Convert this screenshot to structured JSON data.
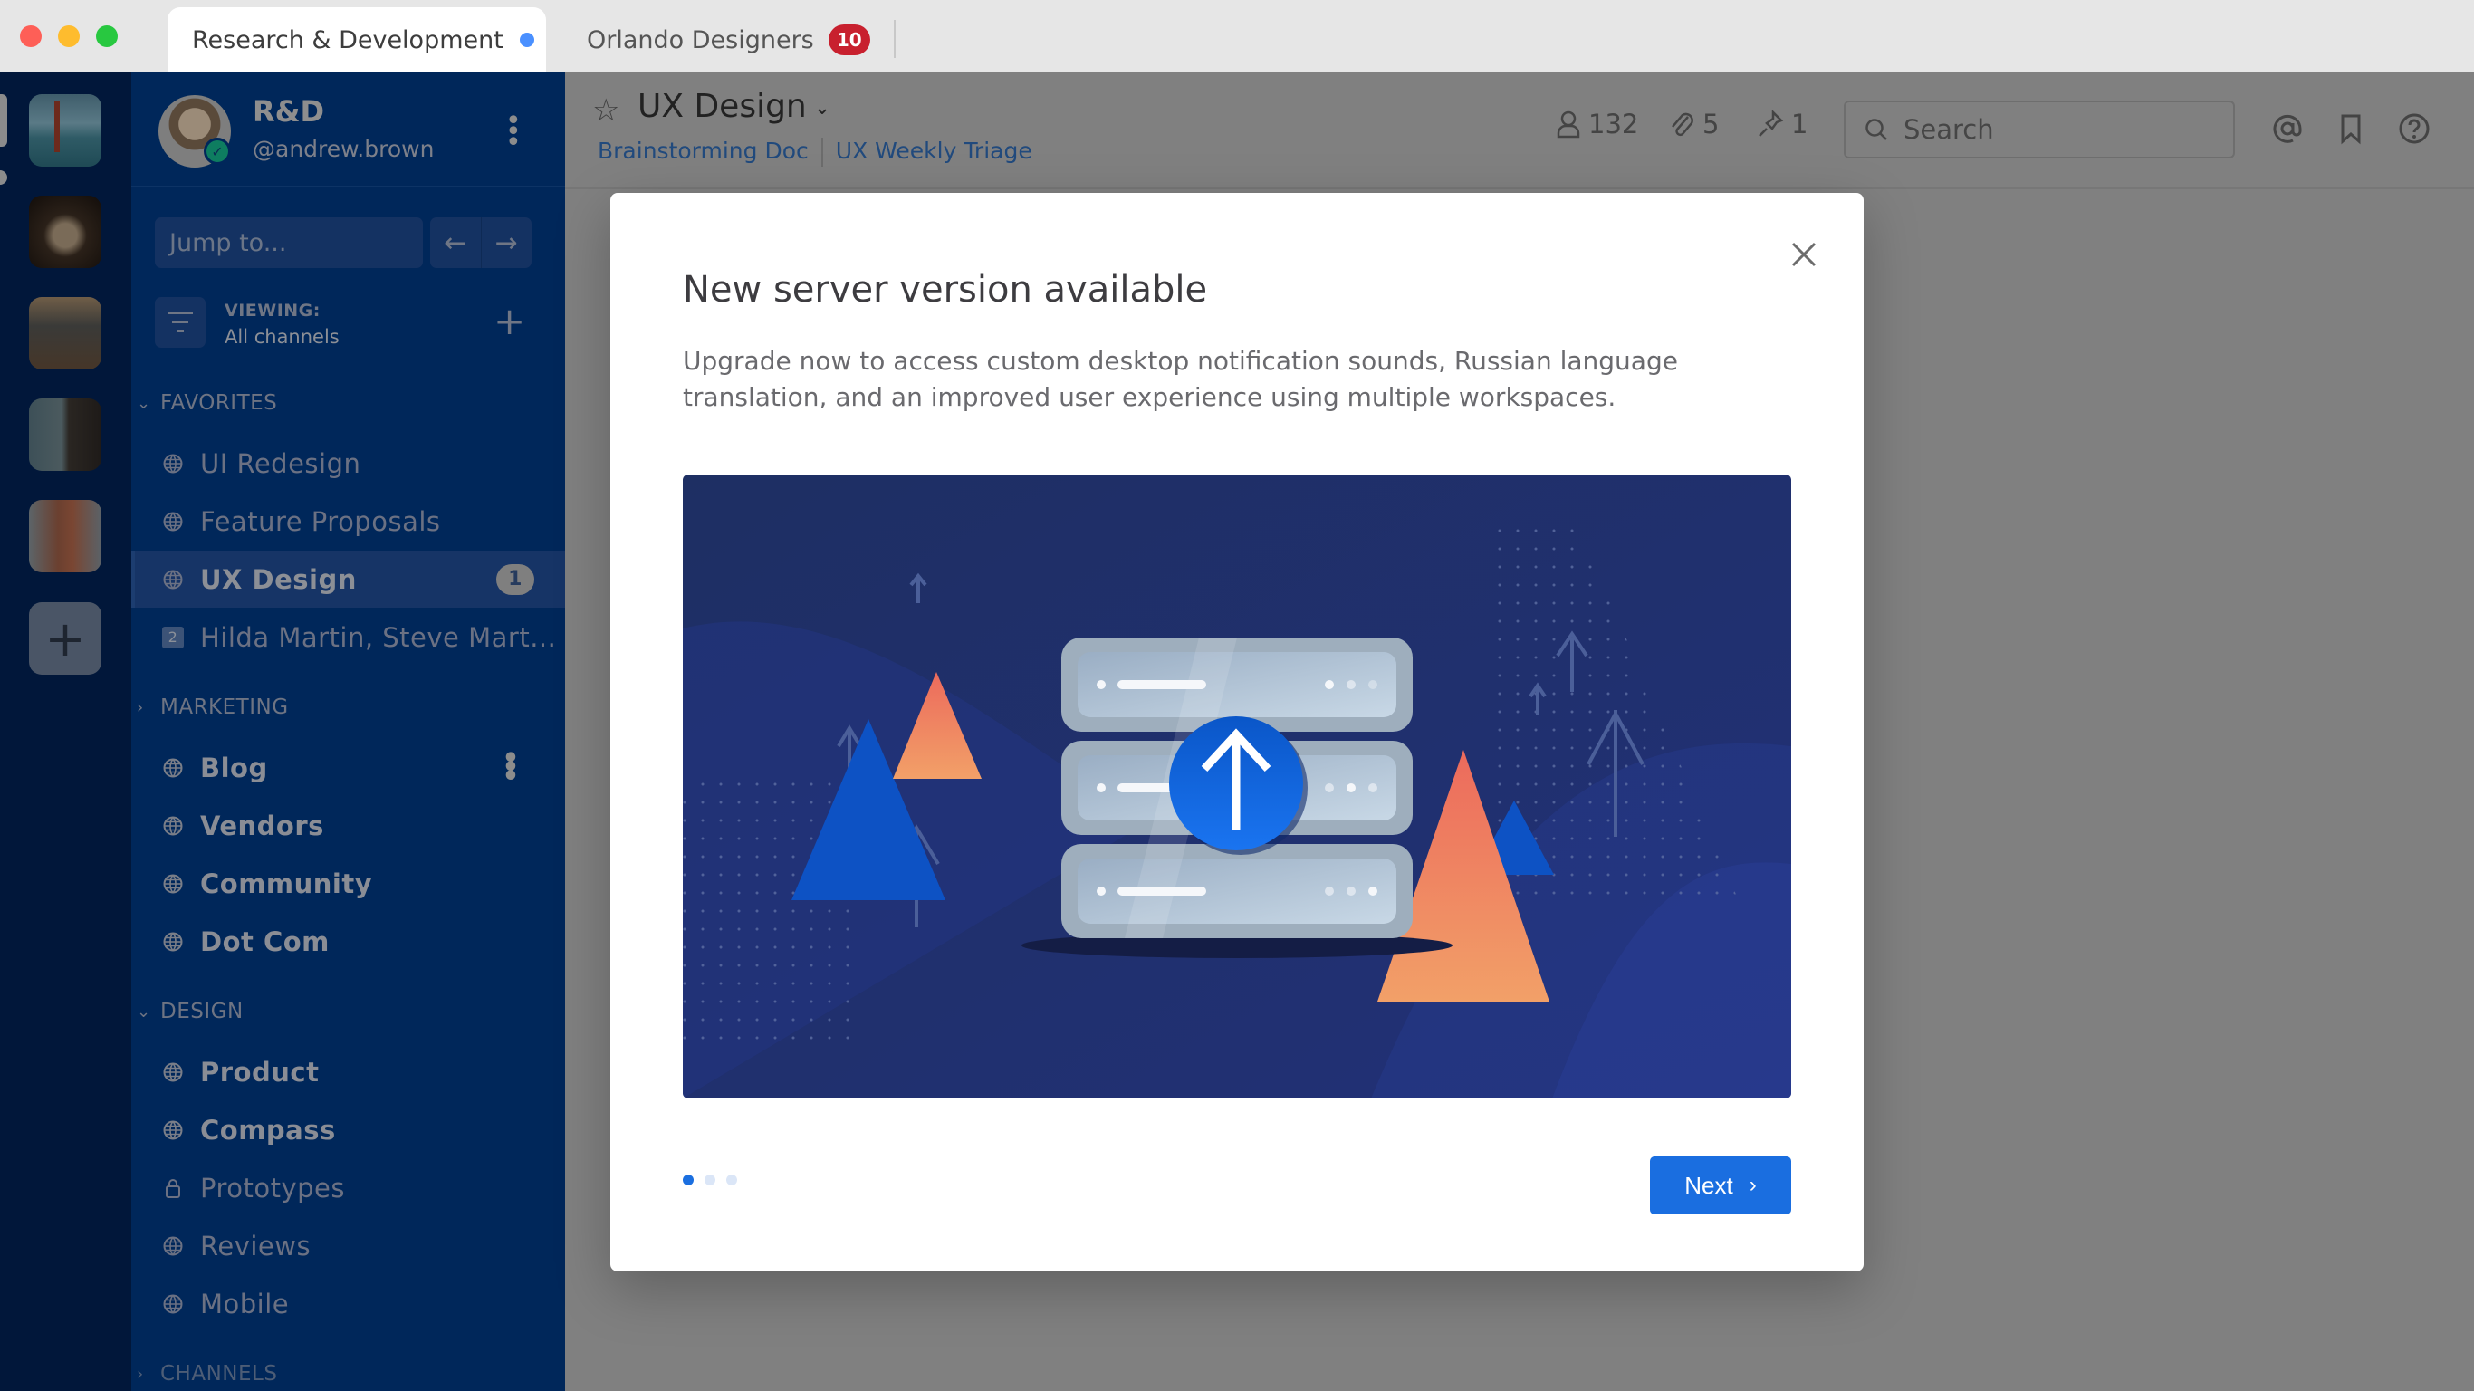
{
  "window": {
    "tabs": [
      {
        "label": "Research & Development",
        "active": true,
        "unread_dot": true
      },
      {
        "label": "Orlando Designers",
        "active": false,
        "badge": "10"
      }
    ]
  },
  "teams": [
    {
      "name": "team-golden-gate",
      "active": true
    },
    {
      "name": "team-cathedral",
      "unread": true
    },
    {
      "name": "team-city-aerial"
    },
    {
      "name": "team-street"
    },
    {
      "name": "team-brick-building"
    }
  ],
  "sidebar": {
    "team_name": "R&D",
    "handle": "@andrew.brown",
    "jump_placeholder": "Jump to...",
    "viewing_label": "VIEWING:",
    "viewing_value": "All channels",
    "sections": [
      {
        "title": "FAVORITES",
        "expanded": true,
        "items": [
          {
            "label": "UI Redesign",
            "icon": "globe-icon"
          },
          {
            "label": "Feature Proposals",
            "icon": "globe-icon"
          },
          {
            "label": "UX Design",
            "icon": "globe-icon",
            "active": true,
            "mentions": "1"
          },
          {
            "label": "Hilda Martin, Steve Mart...",
            "icon": "group-dm-icon",
            "dm_count": "2"
          }
        ]
      },
      {
        "title": "MARKETING",
        "expanded": false,
        "items": [
          {
            "label": "Blog",
            "icon": "globe-icon",
            "unread": true
          },
          {
            "label": "Vendors",
            "icon": "globe-icon",
            "unread": true
          },
          {
            "label": "Community",
            "icon": "globe-icon",
            "unread": true
          },
          {
            "label": "Dot Com",
            "icon": "globe-icon",
            "unread": true
          }
        ]
      },
      {
        "title": "DESIGN",
        "expanded": true,
        "items": [
          {
            "label": "Product",
            "icon": "globe-icon",
            "unread": true
          },
          {
            "label": "Compass",
            "icon": "globe-icon",
            "unread": true
          },
          {
            "label": "Prototypes",
            "icon": "lock-icon"
          },
          {
            "label": "Reviews",
            "icon": "globe-icon"
          },
          {
            "label": "Mobile",
            "icon": "globe-icon"
          }
        ]
      },
      {
        "title": "CHANNELS",
        "expanded": false,
        "items": []
      }
    ]
  },
  "header": {
    "channel_name": "UX Design",
    "bookmarks": [
      "Brainstorming Doc",
      "UX Weekly Triage"
    ],
    "member_count": "132",
    "file_count": "5",
    "pinned_count": "1",
    "search_placeholder": "Search"
  },
  "modal": {
    "title": "New server version available",
    "body": "Upgrade now to access custom desktop notification sounds, Russian language translation, and an improved user experience using multiple workspaces.",
    "page_count": 3,
    "current_page": 1,
    "next_label": "Next"
  },
  "colors": {
    "primary": "#1a6ee0",
    "sidebar_bg": "#00275a",
    "team_sidebar_bg": "#01173a",
    "mention_badge": "#c8202e"
  }
}
